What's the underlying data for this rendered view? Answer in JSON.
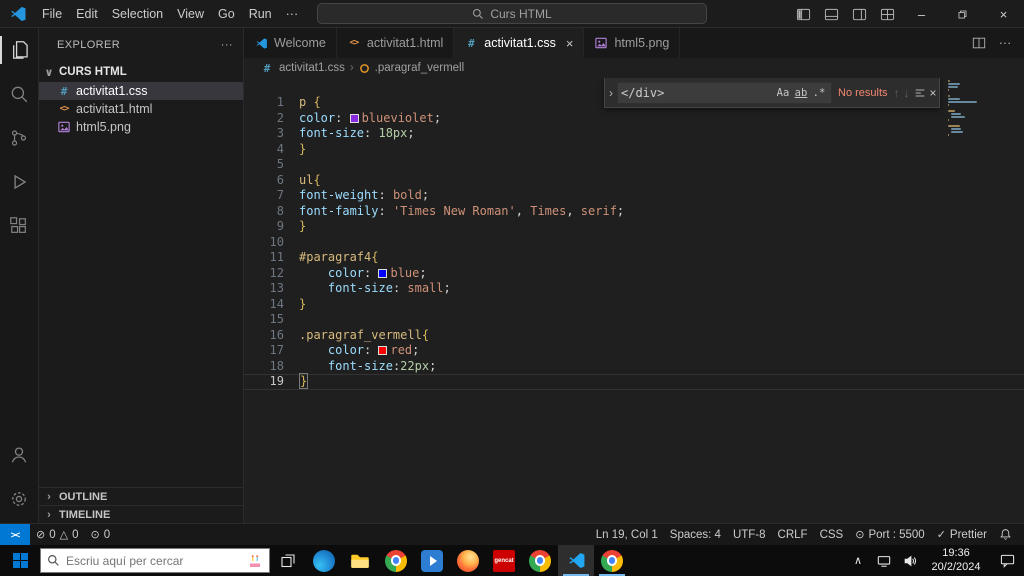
{
  "glyphs": {
    "back": "←",
    "forward": "→",
    "more": "···",
    "chevron_down": "∨",
    "chevron_right": "›",
    "chevron_up": "∧",
    "close": "×",
    "minimize": "–",
    "remote": "><",
    "error": "⊘",
    "warning": "△",
    "broadcast": "⊙",
    "check": "✓",
    "hash": "#",
    "angle_brackets": "<>",
    "arrow_up": "↑",
    "arrow_down": "↓"
  },
  "title_bar": {
    "menus": [
      "File",
      "Edit",
      "Selection",
      "View",
      "Go",
      "Run",
      "···"
    ],
    "command_center": "Curs HTML"
  },
  "explorer": {
    "title": "EXPLORER",
    "folder": "CURS HTML",
    "files": [
      {
        "label": "activitat1.css",
        "type": "css",
        "selected": true
      },
      {
        "label": "activitat1.html",
        "type": "html",
        "selected": false
      },
      {
        "label": "html5.png",
        "type": "image",
        "selected": false
      }
    ],
    "sections": [
      {
        "label": "OUTLINE"
      },
      {
        "label": "TIMELINE"
      }
    ]
  },
  "tabs": [
    {
      "label": "Welcome",
      "type": "vscode",
      "active": false
    },
    {
      "label": "activitat1.html",
      "type": "html",
      "active": false
    },
    {
      "label": "activitat1.css",
      "type": "css",
      "active": true
    },
    {
      "label": "html5.png",
      "type": "image",
      "active": false
    }
  ],
  "breadcrumb": {
    "file": "activitat1.css",
    "symbol": ".paragraf_vermell"
  },
  "find_widget": {
    "query": "</div>",
    "match_case": "Aa",
    "whole_word": "ab",
    "regex": ".*",
    "results": "No results"
  },
  "editor": {
    "cursor": {
      "line": 19,
      "col": 1
    },
    "lines": [
      {
        "n": 1,
        "tokens": [
          [
            "sel",
            "p"
          ],
          [
            "fg",
            " "
          ],
          [
            "brk",
            "{"
          ]
        ]
      },
      {
        "n": 2,
        "tokens": [
          [
            "prop",
            "color"
          ],
          [
            "fg",
            ": "
          ],
          [
            "swatch",
            "#8a2be2"
          ],
          [
            "val",
            "blueviolet"
          ],
          [
            "fg",
            ";"
          ]
        ]
      },
      {
        "n": 3,
        "tokens": [
          [
            "prop",
            "font-size"
          ],
          [
            "fg",
            ": "
          ],
          [
            "num",
            "18px"
          ],
          [
            "fg",
            ";"
          ]
        ]
      },
      {
        "n": 4,
        "tokens": [
          [
            "brk",
            "}"
          ]
        ]
      },
      {
        "n": 5,
        "tokens": []
      },
      {
        "n": 6,
        "tokens": [
          [
            "sel",
            "ul"
          ],
          [
            "brk",
            "{"
          ]
        ]
      },
      {
        "n": 7,
        "tokens": [
          [
            "prop",
            "font-weight"
          ],
          [
            "fg",
            ": "
          ],
          [
            "val",
            "bold"
          ],
          [
            "fg",
            ";"
          ]
        ]
      },
      {
        "n": 8,
        "tokens": [
          [
            "prop",
            "font-family"
          ],
          [
            "fg",
            ": "
          ],
          [
            "val",
            "'Times New Roman'"
          ],
          [
            "fg",
            ", "
          ],
          [
            "val",
            "Times"
          ],
          [
            "fg",
            ", "
          ],
          [
            "val",
            "serif"
          ],
          [
            "fg",
            ";"
          ]
        ]
      },
      {
        "n": 9,
        "tokens": [
          [
            "brk",
            "}"
          ]
        ]
      },
      {
        "n": 10,
        "tokens": []
      },
      {
        "n": 11,
        "tokens": [
          [
            "sel",
            "#paragraf4"
          ],
          [
            "brk",
            "{"
          ]
        ]
      },
      {
        "n": 12,
        "tokens": [
          [
            "ws",
            "    "
          ],
          [
            "prop",
            "color"
          ],
          [
            "fg",
            ": "
          ],
          [
            "swatch",
            "#0000ff"
          ],
          [
            "val",
            "blue"
          ],
          [
            "fg",
            ";"
          ]
        ]
      },
      {
        "n": 13,
        "tokens": [
          [
            "ws",
            "    "
          ],
          [
            "prop",
            "font-size"
          ],
          [
            "fg",
            ": "
          ],
          [
            "val",
            "small"
          ],
          [
            "fg",
            ";"
          ]
        ]
      },
      {
        "n": 14,
        "tokens": [
          [
            "brk",
            "}"
          ]
        ]
      },
      {
        "n": 15,
        "tokens": []
      },
      {
        "n": 16,
        "tokens": [
          [
            "sel",
            ".paragraf_vermell"
          ],
          [
            "brk",
            "{"
          ]
        ]
      },
      {
        "n": 17,
        "tokens": [
          [
            "ws",
            "    "
          ],
          [
            "prop",
            "color"
          ],
          [
            "fg",
            ": "
          ],
          [
            "swatch",
            "#ff0000"
          ],
          [
            "val",
            "red"
          ],
          [
            "fg",
            ";"
          ]
        ]
      },
      {
        "n": 18,
        "tokens": [
          [
            "ws",
            "    "
          ],
          [
            "prop",
            "font-size"
          ],
          [
            "fg",
            ":"
          ],
          [
            "num",
            "22px"
          ],
          [
            "fg",
            ";"
          ]
        ]
      },
      {
        "n": 19,
        "current": true,
        "tokens": [
          [
            "brk",
            "}"
          ]
        ]
      }
    ]
  },
  "status_bar": {
    "left": {
      "errors": "0",
      "warnings": "0",
      "ports": "0"
    },
    "right": [
      {
        "name": "cursor-position",
        "label": "Ln 19, Col 1"
      },
      {
        "name": "indentation",
        "label": "Spaces: 4"
      },
      {
        "name": "encoding",
        "label": "UTF-8"
      },
      {
        "name": "eol",
        "label": "CRLF"
      },
      {
        "name": "language-mode",
        "label": "CSS"
      },
      {
        "name": "live-server-port",
        "label": "Port : 5500",
        "glyph": "⊙"
      },
      {
        "name": "prettier",
        "label": "Prettier",
        "glyph": "✓"
      }
    ]
  },
  "taskbar": {
    "search_placeholder": "Escriu aquí per cercar",
    "apps": [
      {
        "name": "edge",
        "kind": "edge"
      },
      {
        "name": "file-explorer",
        "kind": "folder"
      },
      {
        "name": "chrome-1",
        "kind": "chrome"
      },
      {
        "name": "media-app",
        "kind": "blueapp"
      },
      {
        "name": "firefox",
        "kind": "firefox"
      },
      {
        "name": "gencat",
        "kind": "gencat",
        "label": "gencat"
      },
      {
        "name": "chrome-2",
        "kind": "chrome"
      },
      {
        "name": "vscode",
        "kind": "vscode",
        "active": true
      },
      {
        "name": "chrome-3",
        "kind": "chrome",
        "running": true
      }
    ],
    "clock": {
      "time": "19:36",
      "date": "20/2/2024"
    }
  }
}
